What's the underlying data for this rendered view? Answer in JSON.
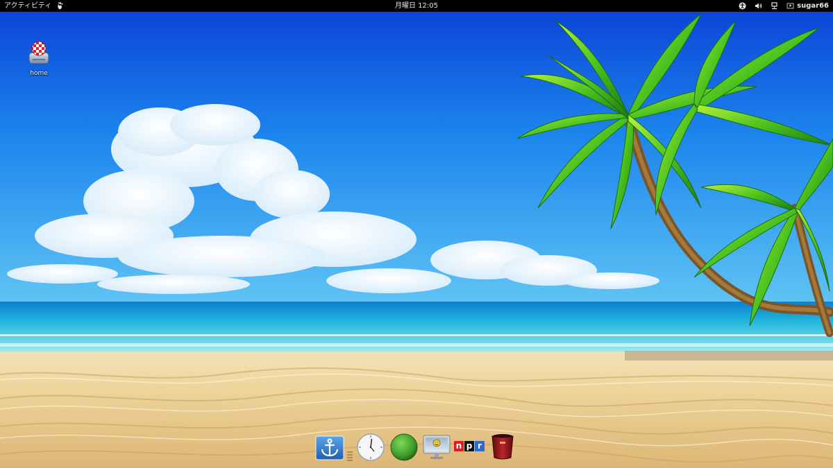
{
  "topbar": {
    "activities_label": "アクティビティ",
    "app_menu_icon": "gnome-foot-icon",
    "clock_text": "月曜日 12:05",
    "tray_icons": [
      "accessibility-icon",
      "volume-icon",
      "network-icon",
      "user-icon"
    ],
    "username": "sugar66"
  },
  "desktop": {
    "icons": [
      {
        "label": "home",
        "icon": "home-drive-icon"
      }
    ]
  },
  "dock": {
    "items": [
      {
        "icon": "anchor-icon"
      },
      {
        "icon": "clock-icon"
      },
      {
        "icon": "green-orb-icon"
      },
      {
        "icon": "monitor-icon"
      },
      {
        "icon": "npr-icon",
        "label": "npr"
      },
      {
        "icon": "trash-icon"
      }
    ]
  },
  "colors": {
    "topbar_bg": "#000000",
    "sky_top": "#0a3fd6",
    "sea": "#1fb4d8",
    "sand": "#ecd39a"
  }
}
